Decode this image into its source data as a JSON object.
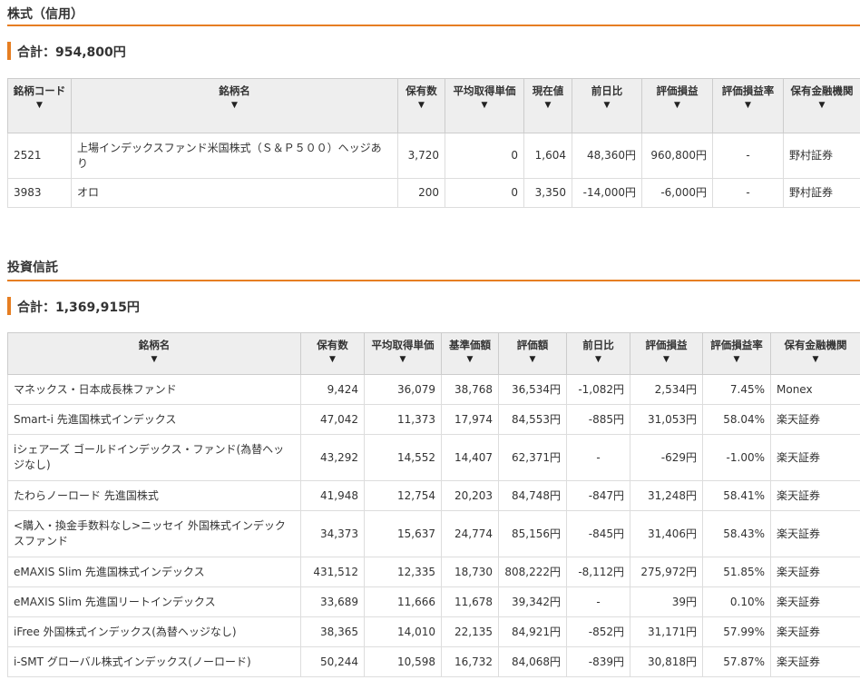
{
  "stock": {
    "title": "株式（信用）",
    "total": "合計：954,800円",
    "headers": [
      "銘柄コード",
      "銘柄名",
      "保有数",
      "平均取得単価",
      "現在値",
      "前日比",
      "評価損益",
      "評価損益率",
      "保有金融機関"
    ],
    "rows": [
      {
        "code": "2521",
        "name": "上場インデックスファンド米国株式（Ｓ＆Ｐ５００）ヘッジあり",
        "qty": "3,720",
        "avg": "0",
        "price": "1,604",
        "change": "48,360円",
        "change_sign": "pos",
        "pl": "960,800円",
        "pl_sign": "pos",
        "rate": "-",
        "bank": "野村証券"
      },
      {
        "code": "3983",
        "name": "オロ",
        "qty": "200",
        "avg": "0",
        "price": "3,350",
        "change": "-14,000円",
        "change_sign": "neg",
        "pl": "-6,000円",
        "pl_sign": "neg",
        "rate": "-",
        "bank": "野村証券"
      }
    ]
  },
  "fund": {
    "title": "投資信託",
    "total": "合計：1,369,915円",
    "headers": [
      "銘柄名",
      "保有数",
      "平均取得単価",
      "基準価額",
      "評価額",
      "前日比",
      "評価損益",
      "評価損益率",
      "保有金融機関"
    ],
    "rows": [
      {
        "name": "マネックス・日本成長株ファンド",
        "qty": "9,424",
        "avg": "36,079",
        "nav": "38,768",
        "value": "36,534円",
        "change": "-1,082円",
        "change_sign": "neg",
        "pl": "2,534円",
        "pl_sign": "pos",
        "rate": "7.45%",
        "rate_sign": "pos",
        "bank": "Monex"
      },
      {
        "name": "Smart-i 先進国株式インデックス",
        "qty": "47,042",
        "avg": "11,373",
        "nav": "17,974",
        "value": "84,553円",
        "change": "-885円",
        "change_sign": "neg",
        "pl": "31,053円",
        "pl_sign": "pos",
        "rate": "58.04%",
        "rate_sign": "pos",
        "bank": "楽天証券"
      },
      {
        "name": "iシェアーズ ゴールドインデックス・ファンド(為替ヘッジなし)",
        "qty": "43,292",
        "avg": "14,552",
        "nav": "14,407",
        "value": "62,371円",
        "change": "-",
        "change_sign": "none",
        "pl": "-629円",
        "pl_sign": "neg",
        "rate": "-1.00%",
        "rate_sign": "neg",
        "bank": "楽天証券"
      },
      {
        "name": "たわらノーロード 先進国株式",
        "qty": "41,948",
        "avg": "12,754",
        "nav": "20,203",
        "value": "84,748円",
        "change": "-847円",
        "change_sign": "neg",
        "pl": "31,248円",
        "pl_sign": "pos",
        "rate": "58.41%",
        "rate_sign": "pos",
        "bank": "楽天証券"
      },
      {
        "name": "<購入・換金手数料なし>ニッセイ 外国株式インデックスファンド",
        "qty": "34,373",
        "avg": "15,637",
        "nav": "24,774",
        "value": "85,156円",
        "change": "-845円",
        "change_sign": "neg",
        "pl": "31,406円",
        "pl_sign": "pos",
        "rate": "58.43%",
        "rate_sign": "pos",
        "bank": "楽天証券"
      },
      {
        "name": "eMAXIS Slim 先進国株式インデックス",
        "qty": "431,512",
        "avg": "12,335",
        "nav": "18,730",
        "value": "808,222円",
        "change": "-8,112円",
        "change_sign": "neg",
        "pl": "275,972円",
        "pl_sign": "pos",
        "rate": "51.85%",
        "rate_sign": "pos",
        "bank": "楽天証券"
      },
      {
        "name": "eMAXIS Slim 先進国リートインデックス",
        "qty": "33,689",
        "avg": "11,666",
        "nav": "11,678",
        "value": "39,342円",
        "change": "-",
        "change_sign": "none",
        "pl": "39円",
        "pl_sign": "pos",
        "rate": "0.10%",
        "rate_sign": "pos",
        "bank": "楽天証券"
      },
      {
        "name": "iFree 外国株式インデックス(為替ヘッジなし)",
        "qty": "38,365",
        "avg": "14,010",
        "nav": "22,135",
        "value": "84,921円",
        "change": "-852円",
        "change_sign": "neg",
        "pl": "31,171円",
        "pl_sign": "pos",
        "rate": "57.99%",
        "rate_sign": "pos",
        "bank": "楽天証券"
      },
      {
        "name": "i-SMT グローバル株式インデックス(ノーロード)",
        "qty": "50,244",
        "avg": "10,598",
        "nav": "16,732",
        "value": "84,068円",
        "change": "-839円",
        "change_sign": "neg",
        "pl": "30,818円",
        "pl_sign": "pos",
        "rate": "57.87%",
        "rate_sign": "pos",
        "bank": "楽天証券"
      }
    ]
  },
  "sort_arrow": "▼",
  "colors": {
    "accent": "#e67e22",
    "positive": "#3a6ea5",
    "negative": "#c0392b",
    "header_bg": "#eeeeee"
  }
}
